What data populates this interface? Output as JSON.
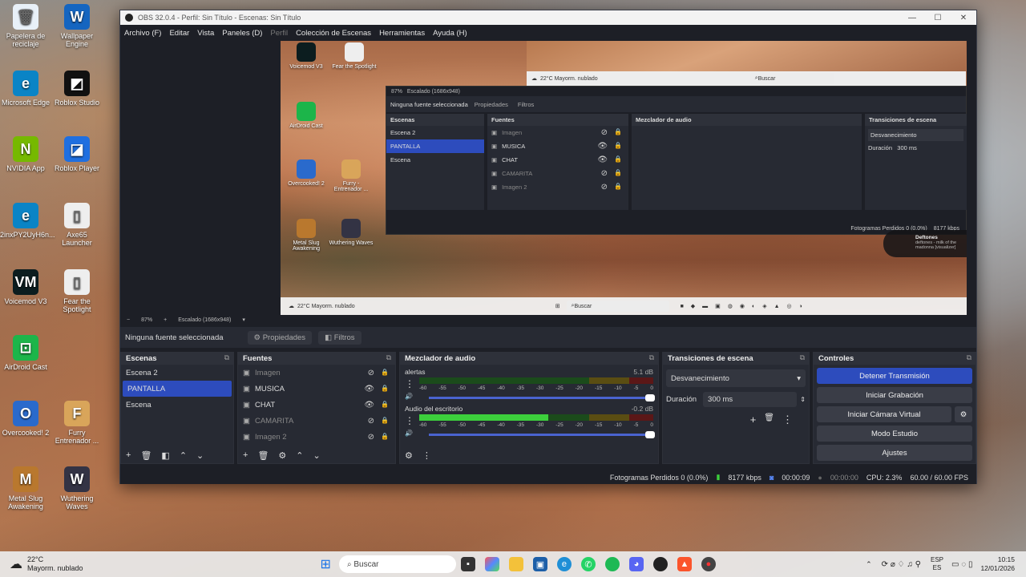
{
  "desktop_icons": [
    {
      "label": "Papelera de reciclaje",
      "glyph": "🗑"
    },
    {
      "label": "Wallpaper Engine",
      "glyph": "W"
    },
    {
      "label": "Microsoft Edge",
      "glyph": "e"
    },
    {
      "label": "Roblox Studio",
      "glyph": "◩"
    },
    {
      "label": "NVIDIA App",
      "glyph": "N"
    },
    {
      "label": "Roblox Player",
      "glyph": "◪"
    },
    {
      "label": "2inxPY2UyH6n...",
      "glyph": "e"
    },
    {
      "label": "Axe65 Launcher",
      "glyph": "▯"
    },
    {
      "label": "Voicemod V3",
      "glyph": "VM"
    },
    {
      "label": "Fear the Spotlight",
      "glyph": "▯"
    },
    {
      "label": "AirDroid Cast",
      "glyph": "⊡"
    },
    {
      "label": "Overcooked! 2",
      "glyph": "O"
    },
    {
      "label": "Furry Entrenador ...",
      "glyph": "F"
    },
    {
      "label": "Metal Slug Awakening",
      "glyph": "M"
    },
    {
      "label": "Wuthering Waves",
      "glyph": "W"
    }
  ],
  "window": {
    "title": "OBS 32.0.4 - Perfil: Sin Título - Escenas: Sin Título"
  },
  "menu": [
    "Archivo (F)",
    "Editar",
    "Vista",
    "Paneles (D)",
    "Perfil",
    "Colección de Escenas",
    "Herramientas",
    "Ayuda (H)"
  ],
  "preview": {
    "zoom": "87%",
    "scaled": "Escalado (1686x948)",
    "nested_weather_temp": "22°C",
    "nested_weather_desc": "Mayorm. nublado",
    "nested_search": "Buscar",
    "nested_icons": [
      "Voicemod V3",
      "Fear the Spotlight",
      "AirDroid Cast",
      "Overcooked! 2",
      "Furry - Entrenador ...",
      "Metal Slug Awakening",
      "Wuthering Waves"
    ],
    "nested_status_dropped": "Fotogramas Perdidos 0 (0.0%)",
    "nested_status_kbps": "8177 kbps",
    "music_artist": "Deftones",
    "music_track": "deftones - milk of the madonna [visualizer]"
  },
  "source_bar": {
    "label": "Ninguna fuente seleccionada",
    "props": "Propiedades",
    "filters": "Filtros"
  },
  "scenes": {
    "title": "Escenas",
    "items": [
      "Escena 2",
      "PANTALLA",
      "Escena"
    ],
    "selected": 1
  },
  "sources": {
    "title": "Fuentes",
    "items": [
      {
        "name": "Imagen",
        "visible": false
      },
      {
        "name": "MUSICA",
        "visible": true
      },
      {
        "name": "CHAT",
        "visible": true
      },
      {
        "name": "CAMARITA",
        "visible": false
      },
      {
        "name": "Imagen 2",
        "visible": false
      }
    ]
  },
  "mixer": {
    "title": "Mezclador de audio",
    "channels": [
      {
        "name": "alertas",
        "db": "5.1 dB",
        "level": 0
      },
      {
        "name": "Audio del escritorio",
        "db": "-0.2 dB",
        "level": 0.55
      }
    ],
    "scale": [
      "-60",
      "-55",
      "-50",
      "-45",
      "-40",
      "-35",
      "-30",
      "-25",
      "-20",
      "-15",
      "-10",
      "-5",
      "0"
    ]
  },
  "transitions": {
    "title": "Transiciones de escena",
    "type": "Desvanecimiento",
    "duration_label": "Duración",
    "duration": "300 ms"
  },
  "controls": {
    "title": "Controles",
    "buttons": [
      "Detener Transmisión",
      "Iniciar Grabación",
      "Iniciar Cámara Virtual",
      "Modo Estudio",
      "Ajustes"
    ]
  },
  "status": {
    "dropped": "Fotogramas Perdidos 0 (0.0%)",
    "kbps": "8177 kbps",
    "live": "00:00:09",
    "rec": "00:00:00",
    "cpu": "CPU: 2.3%",
    "fps": "60.00 / 60.00 FPS"
  },
  "taskbar": {
    "weather_temp": "22°C",
    "weather_desc": "Mayorm. nublado",
    "search": "Buscar",
    "lang1": "ESP",
    "lang2": "ES",
    "time": "10:15",
    "date": "12/01/2026"
  }
}
